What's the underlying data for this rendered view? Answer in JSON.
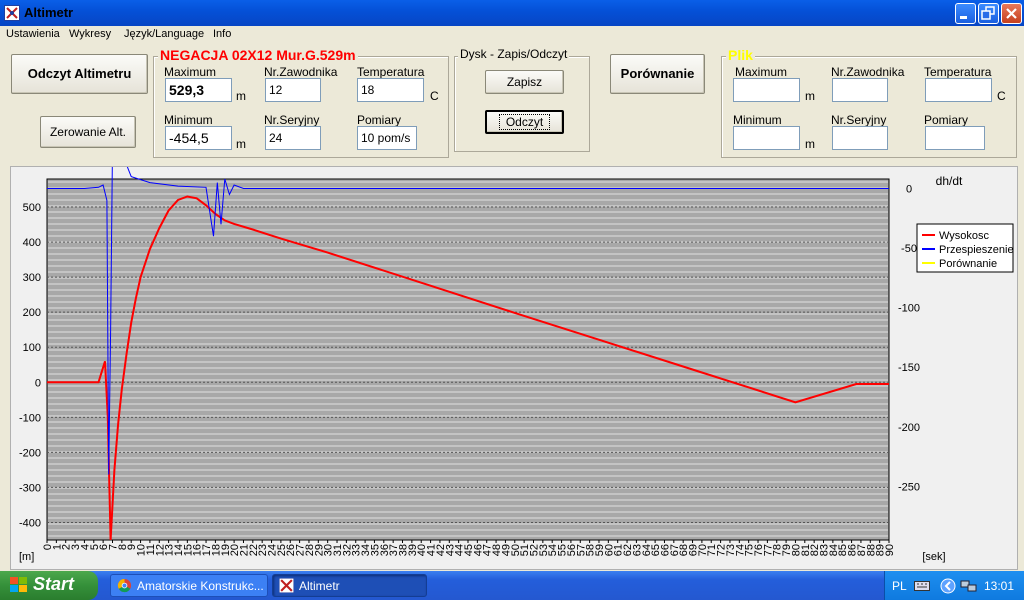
{
  "window": {
    "title": "Altimetr"
  },
  "menu": [
    "Ustawienia",
    "Wykresy",
    "Język/Language",
    "Info"
  ],
  "buttons": {
    "read_altimeter": "Odczyt Altimetru",
    "reset_altimeter": "Zerowanie Alt.",
    "save": "Zapisz",
    "read": "Odczyt",
    "compare": "Porównanie"
  },
  "flight": {
    "title": "NEGACJA 02X12 Mur.G.529m",
    "title_color": "#ff0000",
    "maximum_label": "Maximum",
    "maximum": "529,3",
    "maximum_unit": "m",
    "minimum_label": "Minimum",
    "minimum": "-454,5",
    "minimum_unit": "m",
    "competitor_label": "Nr.Zawodnika",
    "competitor": "12",
    "serial_label": "Nr.Seryjny",
    "serial": "24",
    "temperature_label": "Temperatura",
    "temperature": "18",
    "temperature_unit": "C",
    "samples_label": "Pomiary",
    "samples": "10 pom/s"
  },
  "disk": {
    "title": "Dysk - Zapis/Odczyt"
  },
  "file": {
    "title": "Plik",
    "title_color": "#ffff00",
    "maximum_label": "Maximum",
    "maximum": "",
    "maximum_unit": "m",
    "minimum_label": "Minimum",
    "minimum": "",
    "minimum_unit": "m",
    "competitor_label": "Nr.Zawodnika",
    "competitor": "",
    "serial_label": "Nr.Seryjny",
    "serial": "",
    "temperature_label": "Temperatura",
    "temperature": "",
    "temperature_unit": "C",
    "samples_label": "Pomiary",
    "samples": ""
  },
  "chart_data": {
    "type": "line",
    "xlabel": "[sek]",
    "ylabel": "[m]",
    "y2label": "dh/dt",
    "xlim": [
      0,
      90
    ],
    "ylim": [
      -450,
      580
    ],
    "y2lim": [
      -295,
      8
    ],
    "x_ticks": [
      0,
      1,
      2,
      3,
      4,
      5,
      6,
      7,
      8,
      9,
      10,
      11,
      12,
      13,
      14,
      15,
      16,
      17,
      18,
      19,
      20,
      21,
      22,
      23,
      24,
      25,
      26,
      27,
      28,
      29,
      30,
      31,
      32,
      33,
      34,
      35,
      36,
      37,
      38,
      39,
      40,
      41,
      42,
      43,
      44,
      45,
      46,
      47,
      48,
      49,
      50,
      51,
      52,
      53,
      54,
      55,
      56,
      57,
      58,
      59,
      60,
      61,
      62,
      63,
      64,
      65,
      66,
      67,
      68,
      69,
      70,
      71,
      72,
      73,
      74,
      75,
      76,
      77,
      78,
      79,
      80,
      81,
      82,
      83,
      84,
      85,
      86,
      87,
      88,
      89,
      90
    ],
    "y_ticks": [
      500,
      400,
      300,
      200,
      100,
      0,
      -100,
      -200,
      -300,
      -400
    ],
    "y2_ticks": [
      0,
      -50,
      -100,
      -150,
      -200,
      -250
    ],
    "legend_position": "right",
    "background_color": "#a8a8a8",
    "series": [
      {
        "name": "Wysokosc",
        "color": "#ff0000",
        "axis": "left",
        "x": [
          0,
          5.5,
          6.2,
          6.5,
          6.8,
          7.2,
          7.6,
          8,
          8.5,
          9,
          9.5,
          10,
          11,
          12,
          13,
          14,
          15,
          16,
          17,
          18,
          19,
          20,
          22,
          25,
          30,
          40,
          50,
          60,
          70,
          80,
          86.5,
          90
        ],
        "y": [
          0,
          0,
          60,
          -100,
          -450,
          -250,
          -120,
          -20,
          80,
          170,
          240,
          300,
          380,
          440,
          490,
          520,
          530,
          525,
          505,
          480,
          462,
          452,
          436,
          410,
          370,
          284,
          198,
          113,
          28,
          -57,
          -5,
          -5
        ]
      },
      {
        "name": "Przespieszenie",
        "color": "#0000ff",
        "axis": "right",
        "x": [
          0,
          4,
          5.5,
          6,
          6.4,
          6.6,
          6.8,
          7,
          7.2,
          7.6,
          8,
          9,
          11,
          14,
          17,
          17.8,
          18.2,
          18.6,
          19,
          19.5,
          20,
          21,
          25,
          40,
          60,
          90
        ],
        "y": [
          0,
          0,
          1,
          3,
          -10,
          -240,
          -120,
          35,
          45,
          40,
          30,
          10,
          5,
          2,
          1,
          -40,
          5,
          -30,
          8,
          -5,
          3,
          0,
          0,
          0,
          0,
          0
        ]
      },
      {
        "name": "Porównanie",
        "color": "#ffff00",
        "axis": "left",
        "x": [],
        "y": []
      }
    ]
  },
  "taskbar": {
    "start": "Start",
    "tasks": [
      "Amatorskie Konstrukc...",
      "Altimetr"
    ],
    "language": "PL",
    "clock": "13:01"
  }
}
